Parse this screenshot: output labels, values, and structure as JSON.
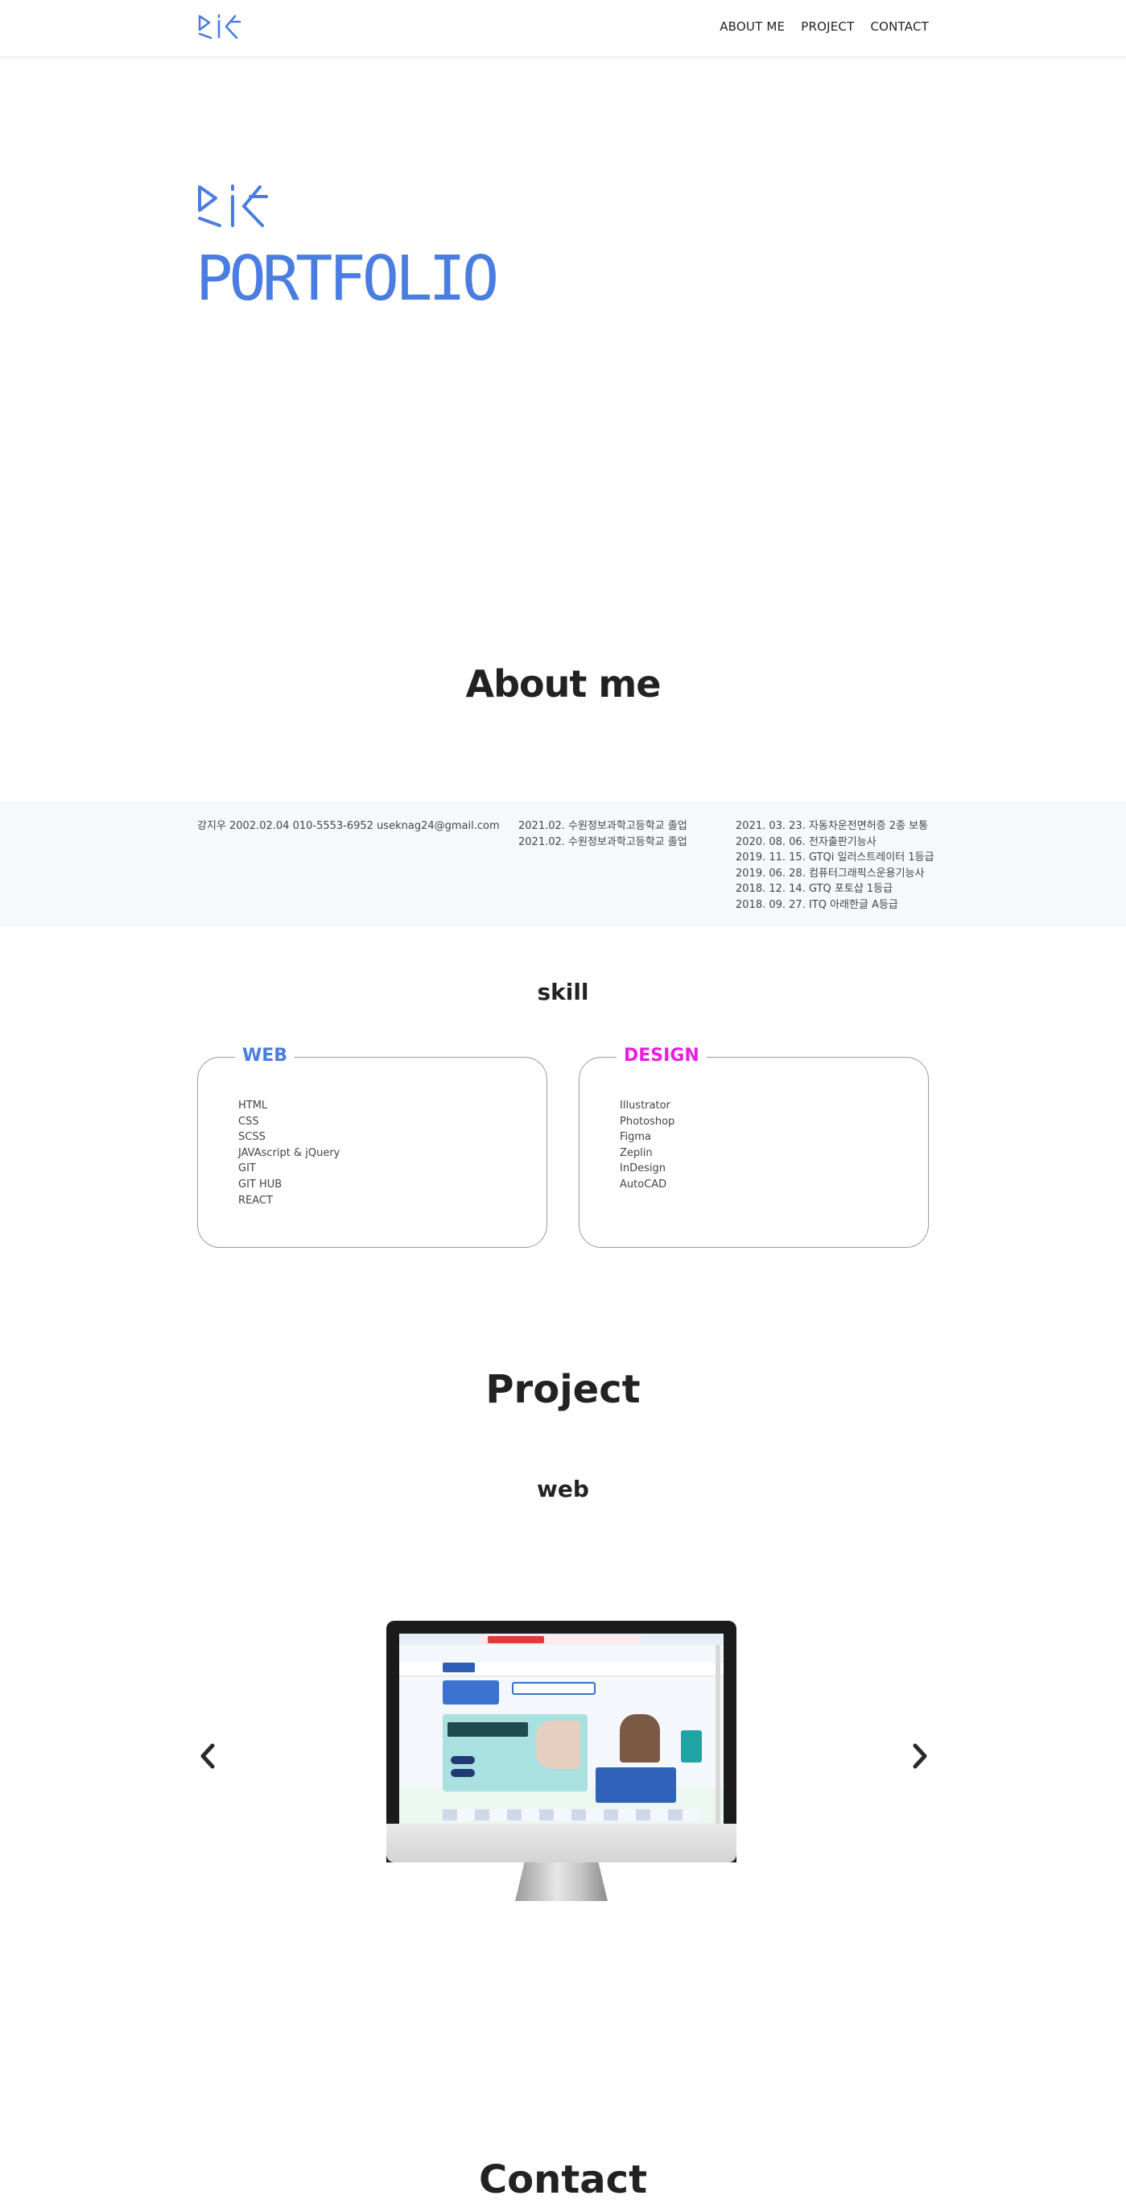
{
  "header": {
    "logo_text": "강지우",
    "nav": [
      "ABOUT ME",
      "PROJECT",
      "CONTACT"
    ]
  },
  "hero": {
    "title": "PORTFOLIO"
  },
  "about": {
    "title": "About me",
    "profile": "강지우 2002.02.04 010-5553-6952 useknag24@gmail.com",
    "education": [
      "2021.02. 수원정보과학고등학교 졸업",
      "2021.02. 수원정보과학고등학교 졸업"
    ],
    "certificates": [
      "2021. 03. 23. 자동차운전면허증 2종 보통",
      "2020. 08. 06. 전자출판기능사",
      "2019. 11. 15. GTQi 일러스트레이터 1등급",
      "2019. 06. 28. 컴퓨터그래픽스운용기능사",
      "2018. 12. 14. GTQ 포토샵 1등급",
      "2018. 09. 27. ITQ 아래한글 A등급"
    ]
  },
  "skill": {
    "title": "skill",
    "web": {
      "label": "WEB",
      "items": [
        "HTML",
        "CSS",
        "SCSS",
        "JAVAscript & jQuery",
        "GIT",
        "GIT HUB",
        "REACT"
      ]
    },
    "design": {
      "label": "DESIGN",
      "items": [
        "Illustrator",
        "Photoshop",
        "Figma",
        "Zeplin",
        "InDesign",
        "AutoCAD"
      ]
    }
  },
  "project": {
    "title": "Project",
    "subtitle": "web",
    "slider": {
      "prev_icon": "chevron-left-icon",
      "next_icon": "chevron-right-icon"
    }
  },
  "contact": {
    "title": "Contact"
  },
  "colors": {
    "accent_blue": "#4a7de0",
    "accent_magenta": "#e81ee0",
    "about_band_bg": "#f6f9fc"
  }
}
